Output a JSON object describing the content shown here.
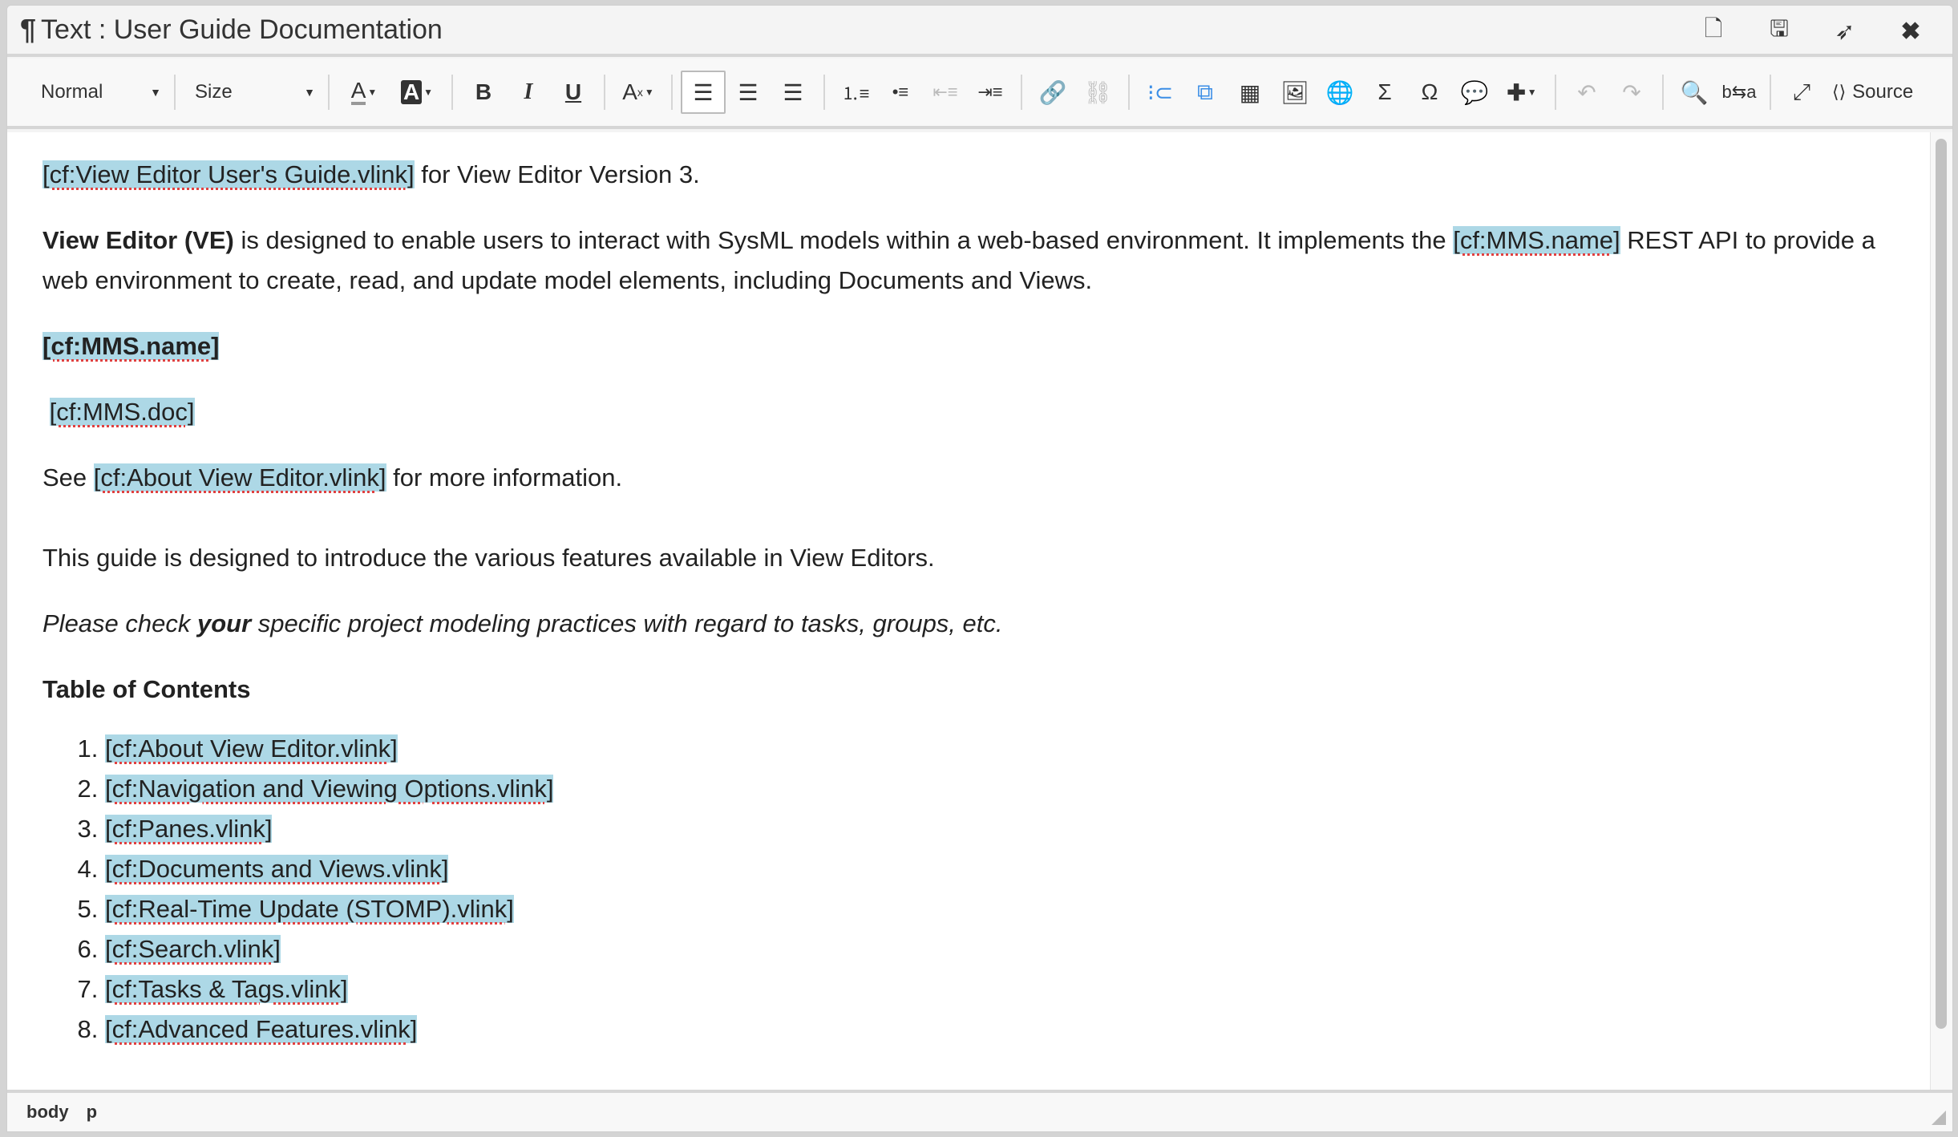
{
  "window": {
    "icon": "pilcrow-icon",
    "title": "Text : User Guide Documentation",
    "actions": [
      {
        "name": "pdf-icon",
        "glyph": "🗎"
      },
      {
        "name": "save-icon",
        "glyph": "💾"
      },
      {
        "name": "send-icon",
        "glyph": "➢"
      },
      {
        "name": "close-icon",
        "glyph": "✖"
      }
    ]
  },
  "toolbar": {
    "format": "Normal",
    "size": "Size",
    "source": "Source"
  },
  "content": {
    "p1_link": "[cf:View Editor User's Guide.vlink]",
    "p1_rest": " for View Editor Version 3.",
    "p2_bold": "View Editor (VE)",
    "p2_a": " is designed to enable users to interact with SysML models within a web-based environment. It implements the ",
    "p2_link": "[cf:MMS.name]",
    "p2_b": " REST API to provide a web environment to create, read, and update model elements, including Documents and Views.",
    "p3_link": "[cf:MMS.name]",
    "p4_link": "[cf:MMS.doc]",
    "p5_a": "See ",
    "p5_link": "[cf:About View Editor.vlink]",
    "p5_b": " for more information.",
    "p6": "This guide is designed to introduce the various features available in View Editors.",
    "p7_a": "Please check ",
    "p7_bold": "your",
    "p7_b": " specific project modeling practices with regard to tasks, groups, etc.",
    "toc_title": "Table of Contents",
    "toc": [
      "[cf:About View Editor.vlink]",
      "[cf:Navigation and Viewing Options.vlink]",
      "[cf:Panes.vlink]",
      "[cf:Documents and Views.vlink]",
      "[cf:Real-Time Update (STOMP).vlink]",
      "[cf:Search.vlink]",
      "[cf:Tasks & Tags.vlink]",
      "[cf:Advanced Features.vlink]"
    ]
  },
  "status": {
    "path": [
      "body",
      "p"
    ]
  },
  "colors": {
    "link_highlight": "#add8e6",
    "spell_underline": "#e04040",
    "accent": "#3c8ee6"
  }
}
